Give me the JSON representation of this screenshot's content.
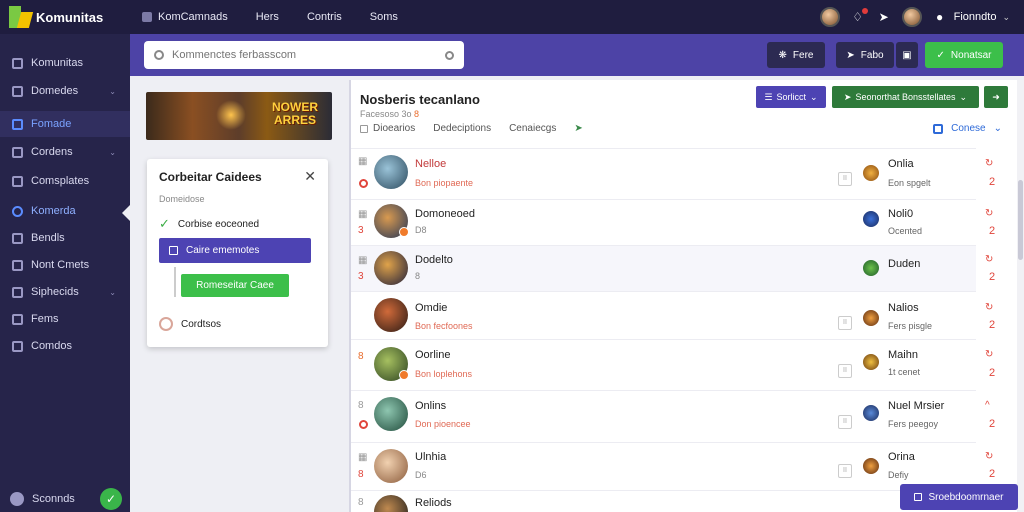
{
  "app": {
    "brand": "Komunitas"
  },
  "topnav": {
    "items": [
      {
        "label": "KomCamnads",
        "icon": "square-icon"
      },
      {
        "label": "Hers"
      },
      {
        "label": "Contris"
      },
      {
        "label": "Soms"
      }
    ],
    "user_name": "Fionndto"
  },
  "sidebar": {
    "items": [
      {
        "label": "Komunitas",
        "icon": "tv-icon"
      },
      {
        "label": "Domedes",
        "icon": "house-icon",
        "chevron": "⌄"
      },
      {
        "label": "Fomade",
        "icon": "list-icon"
      },
      {
        "label": "Cordens",
        "icon": "card-icon",
        "chevron": "⌄"
      },
      {
        "label": "Comsplates",
        "icon": "wrench-icon"
      },
      {
        "label": "Komerda",
        "icon": "circle-icon"
      },
      {
        "label": "Bendls",
        "icon": "calendar-icon"
      },
      {
        "label": "Nont Cmets",
        "icon": "grid-icon"
      },
      {
        "label": "Siphecids",
        "icon": "heart-icon",
        "chevron": "⌄"
      },
      {
        "label": "Fems",
        "icon": "tag-icon"
      },
      {
        "label": "Comdos",
        "icon": "gear-icon"
      }
    ],
    "footer_label": "Sconnds",
    "footer_button": "✓"
  },
  "search": {
    "placeholder": "Kommenctes ferbasscom"
  },
  "toolbar": {
    "dark_label": "Fere",
    "mid_label": "Fabo",
    "green_label": "Nonatsar"
  },
  "banner": {
    "title_line1": "NOWER",
    "title_line2": "ARRES"
  },
  "popup": {
    "title": "Corbeitar Caidees",
    "subtitle": "Domeidose",
    "checked_label": "Corbise eoceoned",
    "primary_label": "Caire ememotes",
    "green_label": "Romeseitar Caee",
    "footer_label": "Cordtsos"
  },
  "panel": {
    "title": "Nosberis tecanlano",
    "meta": "Facesoso 3o",
    "meta_badge": "8",
    "tabs": [
      "Dioearios",
      "Dedeciptions",
      "Cenaiecgs"
    ],
    "pill_blue": "Sorlicct",
    "pill_green": "Seonorthat Bonsstellates",
    "compose": "Conese"
  },
  "rows": [
    {
      "name": "Nelloe",
      "sub": "Bon piopaente",
      "gutter": "",
      "right_label": "Onlia",
      "right_sub": "Eon spgelt",
      "num": "2",
      "follow": "↻"
    },
    {
      "name": "Domoneoed",
      "sub": "D8",
      "gutter": "3",
      "right_label": "Noli0",
      "right_sub": "Ocented",
      "num": "2",
      "follow": "↻"
    },
    {
      "name": "Dodelto",
      "sub": "8",
      "gutter": "3",
      "right_label": "Duden",
      "right_sub": "",
      "num": "2",
      "follow": "↻"
    },
    {
      "name": "Omdie",
      "sub": "Bon fecfoones",
      "gutter": "",
      "right_label": "Nalios",
      "right_sub": "Fers pisgle",
      "num": "2",
      "follow": "↻"
    },
    {
      "name": "Oorline",
      "sub": "Bon loplehons",
      "gutter": "8",
      "right_label": "Maihn",
      "right_sub": "1t cenet",
      "num": "2",
      "follow": "↻"
    },
    {
      "name": "Onlins",
      "sub": "Don pioencee",
      "gutter": "8",
      "right_label": "Nuel Mrsier",
      "right_sub": "Fers peegoy",
      "num": "2",
      "follow": "^"
    },
    {
      "name": "Ulnhia",
      "sub": "D6",
      "gutter": "8",
      "right_label": "Orina",
      "right_sub": "Defiy",
      "num": "2",
      "follow": "↻"
    },
    {
      "name": "Reliods",
      "sub": "",
      "gutter": "8",
      "right_label": "",
      "right_sub": "",
      "num": "",
      "follow": ""
    }
  ],
  "toast": {
    "label": "Sroebdoomrnaer"
  },
  "colors": {
    "topnav": "#1f1d3f",
    "sidebar": "#26244a",
    "accent_purple": "#4d43a6",
    "accent_green": "#3cbf4a",
    "alert_red": "#e0453b"
  }
}
